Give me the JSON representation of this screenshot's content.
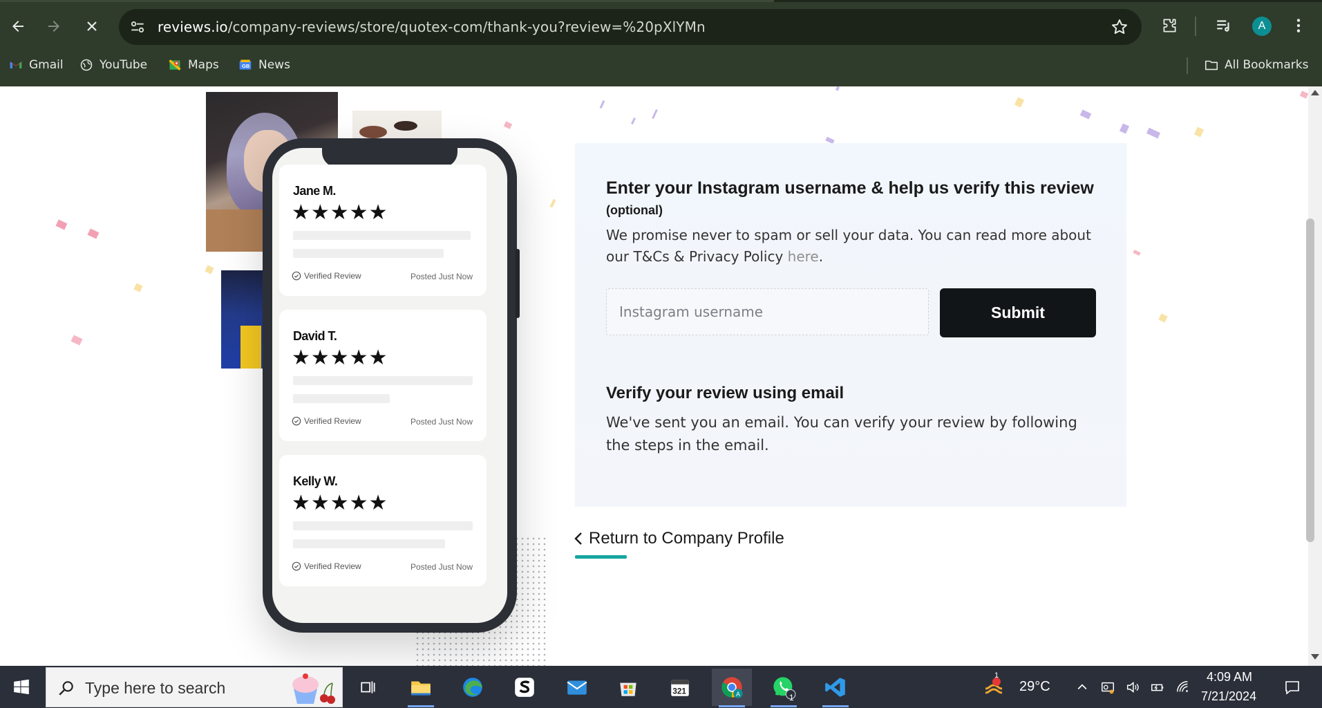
{
  "browser": {
    "url_host": "reviews.io",
    "url_path": "/company-reviews/store/quotex-com/thank-you?review=%20pXlYMn",
    "profile_initial": "A",
    "bookmarks": [
      {
        "label": "Gmail",
        "icon": "gmail-icon"
      },
      {
        "label": "YouTube",
        "icon": "globe-icon"
      },
      {
        "label": "Maps",
        "icon": "maps-icon"
      },
      {
        "label": "News",
        "icon": "news-icon"
      }
    ],
    "all_bookmarks_label": "All Bookmarks"
  },
  "phone_reviews": [
    {
      "name": "Jane M.",
      "stars": "★★★★★",
      "verified": "Verified Review",
      "posted": "Posted Just Now"
    },
    {
      "name": "David T.",
      "stars": "★★★★★",
      "verified": "Verified Review",
      "posted": "Posted Just Now"
    },
    {
      "name": "Kelly W.",
      "stars": "★★★★★",
      "verified": "Verified Review",
      "posted": "Posted Just Now"
    }
  ],
  "verify": {
    "instagram_heading": "Enter your Instagram username & help us verify this review",
    "optional_label": "(optional)",
    "privacy_text": "We promise never to spam or sell your data. You can read more about our T&Cs & Privacy Policy",
    "privacy_link": "here",
    "privacy_end": ".",
    "username_placeholder": "Instagram username",
    "username_value": "",
    "submit_label": "Submit",
    "email_heading": "Verify your review using email",
    "email_text": "We've sent you an email. You can verify your review by following the steps in the email."
  },
  "return_link": "Return to Company Profile",
  "colors": {
    "accent": "#16a6a0",
    "submit_bg": "#121517",
    "chrome_bg": "#2f3b2b",
    "panel_bg": "#f1f7fc"
  },
  "taskbar": {
    "search_placeholder": "Type here to search",
    "weather_temp": "29°C",
    "weather_badge": "1",
    "whatsapp_badge": "1",
    "time": "4:09 AM",
    "date": "7/21/2024"
  }
}
